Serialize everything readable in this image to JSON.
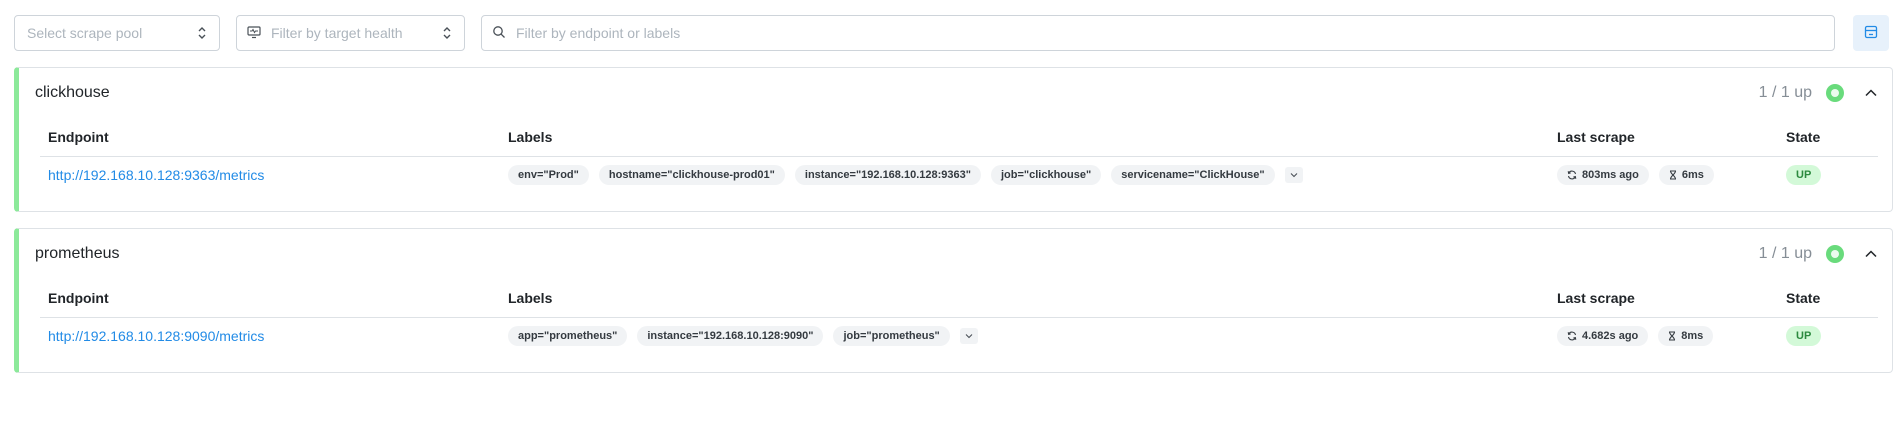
{
  "toolbar": {
    "pool_select_placeholder": "Select scrape pool",
    "health_filter_placeholder": "Filter by target health",
    "search_placeholder": "Filter by endpoint or labels"
  },
  "columns": {
    "endpoint": "Endpoint",
    "labels": "Labels",
    "last_scrape": "Last scrape",
    "state": "State"
  },
  "pools": [
    {
      "name": "clickhouse",
      "health_summary": "1 / 1 up",
      "targets": [
        {
          "endpoint": "http://192.168.10.128:9363/metrics",
          "labels": [
            "env=\"Prod\"",
            "hostname=\"clickhouse-prod01\"",
            "instance=\"192.168.10.128:9363\"",
            "job=\"clickhouse\"",
            "servicename=\"ClickHouse\""
          ],
          "last_scrape": "803ms ago",
          "scrape_duration": "6ms",
          "state": "UP"
        }
      ]
    },
    {
      "name": "prometheus",
      "health_summary": "1 / 1 up",
      "targets": [
        {
          "endpoint": "http://192.168.10.128:9090/metrics",
          "labels": [
            "app=\"prometheus\"",
            "instance=\"192.168.10.128:9090\"",
            "job=\"prometheus\""
          ],
          "last_scrape": "4.682s ago",
          "scrape_duration": "8ms",
          "state": "UP"
        }
      ]
    }
  ],
  "colors": {
    "accent": "#228be6",
    "healthy": "#69db7c",
    "pool_border": "#8ce99a"
  }
}
